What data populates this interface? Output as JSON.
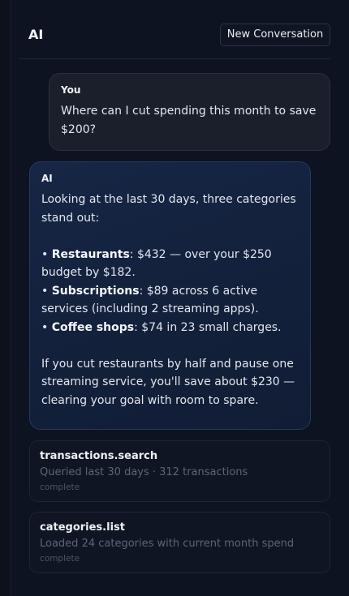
{
  "header": {
    "title": "AI",
    "new_conversation_label": "New Conversation"
  },
  "messages": [
    {
      "sender": "You",
      "text": "Where can I cut spending this month to save $200?"
    },
    {
      "sender": "AI",
      "intro": "Looking at the last 30 days, three categories stand out:",
      "bullets": [
        {
          "label": "Restaurants",
          "text": ": $432 — over your $250 budget by $182."
        },
        {
          "label": "Subscriptions",
          "text": ": $89 across 6 active services (including 2 streaming apps)."
        },
        {
          "label": "Coffee shops",
          "text": ": $74 in 23 small charges."
        }
      ],
      "conclusion": "If you cut restaurants by half and pause one streaming service, you'll save about $230 — clearing your goal with room to spare."
    }
  ],
  "tools": [
    {
      "name": "transactions.search",
      "detail": "Queried last 30 days · 312 transactions",
      "status": "complete"
    },
    {
      "name": "categories.list",
      "detail": "Loaded 24 categories with current month spend",
      "status": "complete"
    }
  ],
  "colors": {
    "background": "#0c111b",
    "ai_bubble": "#152441",
    "user_bubble": "#1a1f2b",
    "muted_text": "#5d6576"
  }
}
